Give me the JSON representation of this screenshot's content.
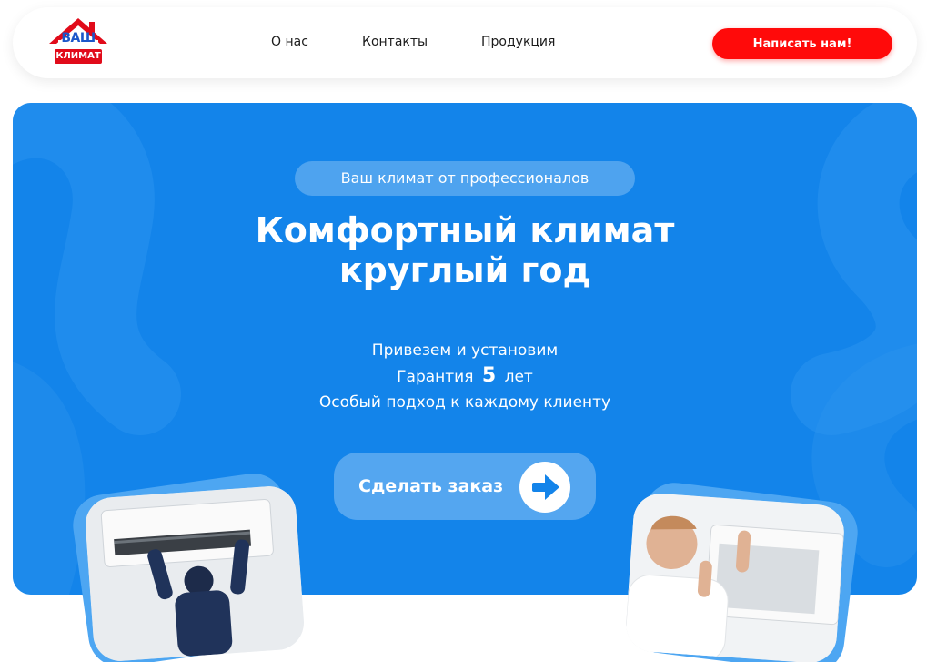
{
  "header": {
    "logo": {
      "top_text": "ВАШ",
      "bottom_text": "КЛИМАТ"
    },
    "nav": [
      {
        "label": "О нас"
      },
      {
        "label": "Контакты"
      },
      {
        "label": "Продукция"
      }
    ],
    "cta_label": "Написать нам!"
  },
  "hero": {
    "badge": "Ваш климат от профессионалов",
    "title_line1": "Комфортный климат",
    "title_line2": "круглый год",
    "features": {
      "line1": "Привезем и установим",
      "line2_prefix": "Гарантия",
      "line2_number": "5",
      "line2_suffix": "лет",
      "line3": "Особый подход к каждому клиенту"
    },
    "order_button_label": "Сделать заказ"
  },
  "colors": {
    "brand_blue": "#1384ea",
    "accent_red": "#ff0a0a",
    "logo_blue": "#1b56c9",
    "logo_red": "#e10b1a"
  },
  "icons": {
    "logo_roof": "house-roof-icon",
    "order_arrow": "arrow-right-icon"
  }
}
